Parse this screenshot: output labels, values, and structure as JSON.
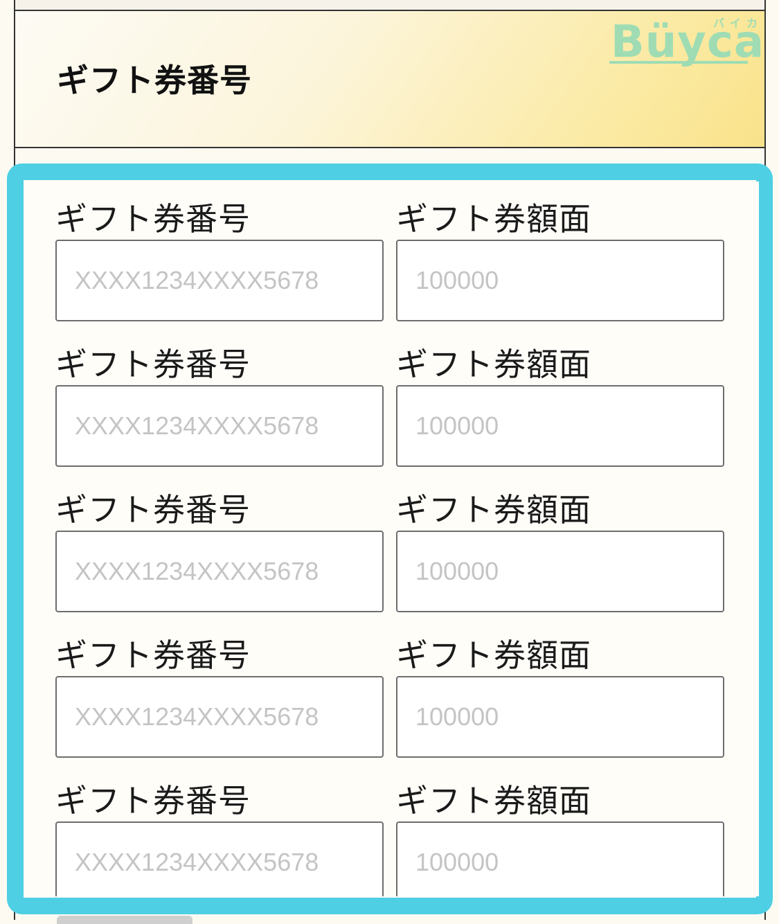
{
  "header": {
    "title": "ギフト券番号",
    "logo_text": "Büyca",
    "logo_kana": "バイカ"
  },
  "colors": {
    "highlight": "#4ecfe3",
    "header_gradient_end": "#f9e28a",
    "logo": "#9fdcb4"
  },
  "rows": [
    {
      "number_label": "ギフト券番号",
      "number_placeholder": "XXXX1234XXXX5678",
      "number_value": "",
      "amount_label": "ギフト券額面",
      "amount_placeholder": "100000",
      "amount_value": ""
    },
    {
      "number_label": "ギフト券番号",
      "number_placeholder": "XXXX1234XXXX5678",
      "number_value": "",
      "amount_label": "ギフト券額面",
      "amount_placeholder": "100000",
      "amount_value": ""
    },
    {
      "number_label": "ギフト券番号",
      "number_placeholder": "XXXX1234XXXX5678",
      "number_value": "",
      "amount_label": "ギフト券額面",
      "amount_placeholder": "100000",
      "amount_value": ""
    },
    {
      "number_label": "ギフト券番号",
      "number_placeholder": "XXXX1234XXXX5678",
      "number_value": "",
      "amount_label": "ギフト券額面",
      "amount_placeholder": "100000",
      "amount_value": ""
    },
    {
      "number_label": "ギフト券番号",
      "number_placeholder": "XXXX1234XXXX5678",
      "number_value": "",
      "amount_label": "ギフト券額面",
      "amount_placeholder": "100000",
      "amount_value": ""
    }
  ]
}
